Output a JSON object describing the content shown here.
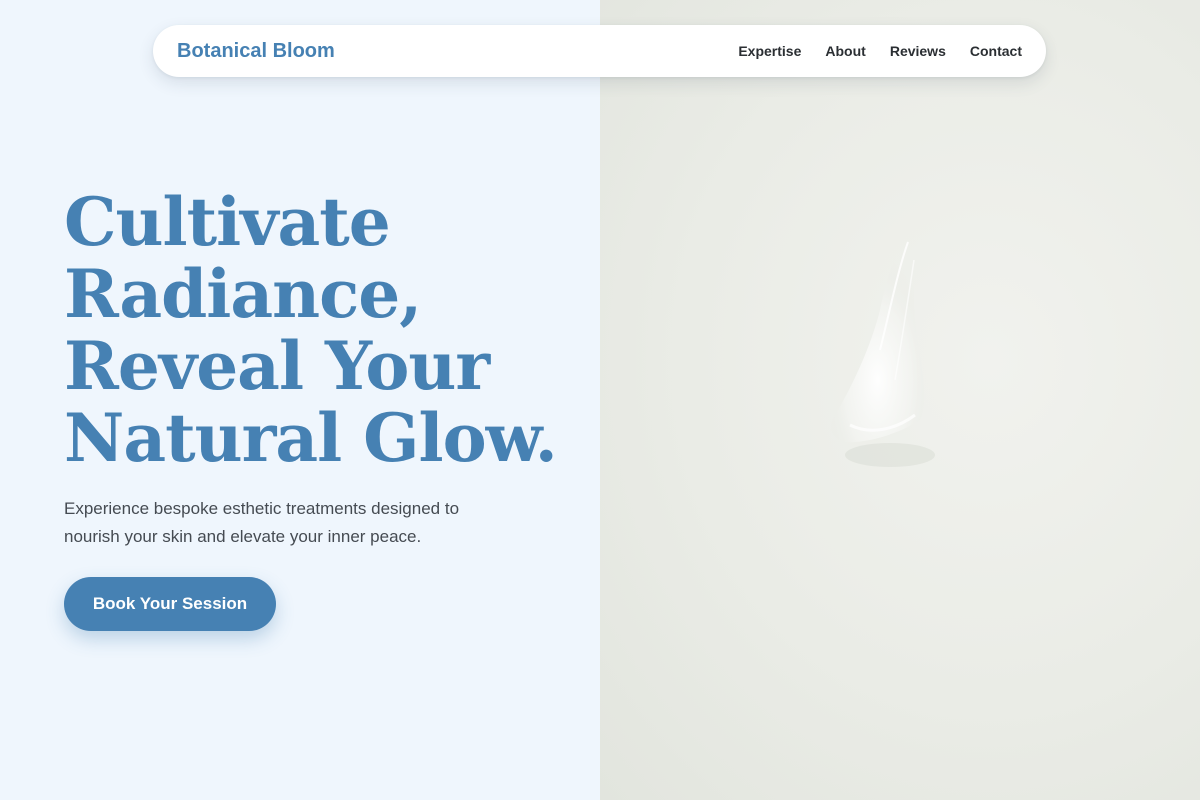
{
  "nav": {
    "brand": "Botanical Bloom",
    "links": [
      "Expertise",
      "About",
      "Reviews",
      "Contact"
    ]
  },
  "hero": {
    "title_lines": [
      "Cultivate",
      "Radiance,",
      "Reveal Your",
      "Natural Glow."
    ],
    "subtitle": "Experience bespoke esthetic treatments designed to nourish your skin and elevate your inner peace.",
    "cta_label": "Book Your Session"
  },
  "colors": {
    "accent": "#4681b3",
    "left_background": "#eff6fd",
    "right_background": "#eaece6",
    "body_text": "#454b52",
    "nav_text": "#2b2f33"
  }
}
